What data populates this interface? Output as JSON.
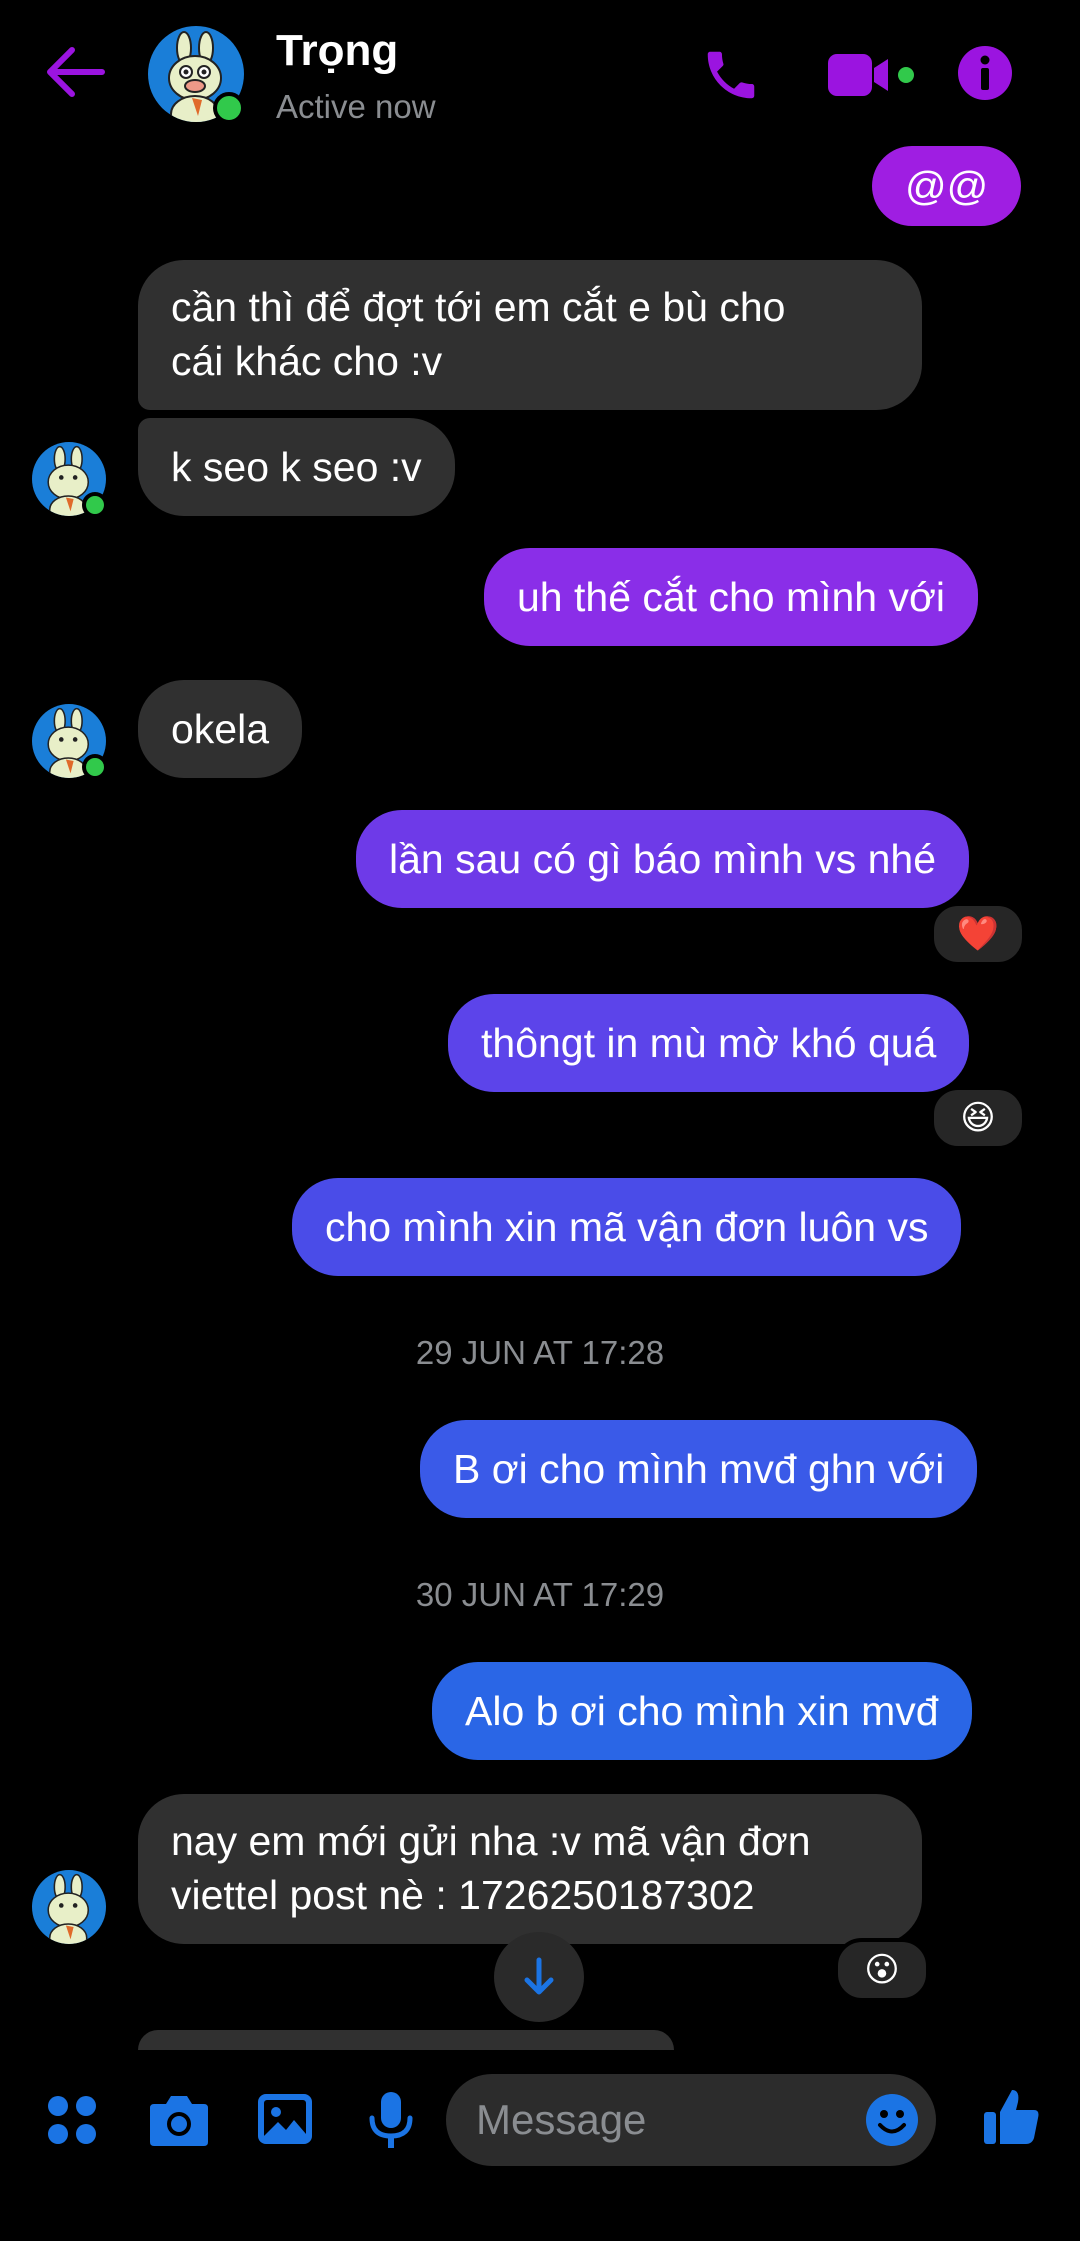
{
  "header": {
    "name": "Trọng",
    "status": "Active now"
  },
  "messages": [
    {
      "side": "out",
      "text": "@@"
    },
    {
      "side": "in",
      "lines": [
        "cần thì để đợt tới em cắt e bù cho",
        "cái khác cho :v"
      ]
    },
    {
      "side": "in",
      "text": "k seo k seo :v"
    },
    {
      "side": "out",
      "text": "uh thế cắt cho mình với"
    },
    {
      "side": "in",
      "text": "okela"
    },
    {
      "side": "out",
      "text": "lần sau có gì báo mình vs nhé",
      "reaction": "❤️"
    },
    {
      "side": "out",
      "text": "thôngt in mù mờ khó quá",
      "reaction": "😆"
    },
    {
      "side": "out",
      "text": "cho mình xin mã vận đơn luôn vs"
    },
    {
      "side": "out",
      "text": "B ơi cho mình mvđ ghn với"
    },
    {
      "side": "out",
      "text": "Alo b ơi cho mình xin mvđ"
    },
    {
      "side": "in",
      "lines": [
        "nay em mới gửi nha :v mã vận đơn",
        "viettel post nè : 1726250187302"
      ],
      "reaction": "😮"
    }
  ],
  "timestamps": [
    "29 JUN AT 17:28",
    "30 JUN AT 17:29"
  ],
  "composer": {
    "placeholder": "Message"
  },
  "icons": {
    "back": "back-arrow-icon",
    "call": "phone-icon",
    "video": "video-camera-icon",
    "info": "info-icon",
    "menu": "four-dots-icon",
    "camera": "camera-icon",
    "gallery": "image-icon",
    "mic": "microphone-icon",
    "emoji": "smiley-icon",
    "like": "thumbs-up-icon",
    "scroll": "arrow-down-icon"
  },
  "colors": {
    "accent": "#9b14e0",
    "icon_blue": "#1b74e4",
    "bubble_in": "#303030",
    "online": "#31c94b"
  }
}
